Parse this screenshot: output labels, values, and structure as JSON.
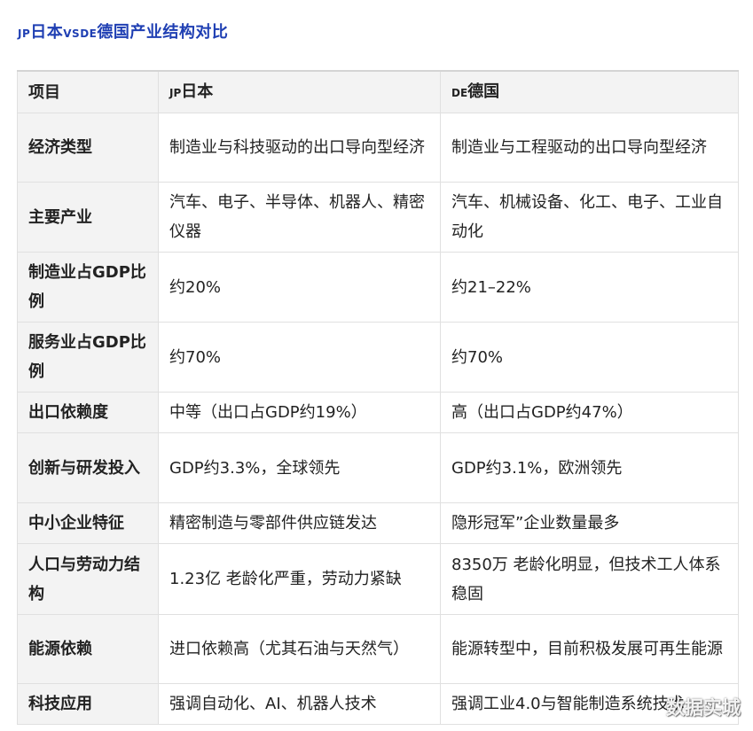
{
  "title": {
    "jp": "JP",
    "japan": "日本",
    "vsde": "VSDE",
    "rest": "德国产业结构对比"
  },
  "table": {
    "headers": {
      "item": "项目",
      "japan_code": "JP",
      "japan": "日本",
      "germany_code": "DE",
      "germany": "德国"
    },
    "rows": [
      {
        "label": "经济类型",
        "japan": "制造业与科技驱动的出口导向型经济",
        "germany": "制造业与工程驱动的出口导向型经济"
      },
      {
        "label": "主要产业",
        "japan": "汽车、电子、半导体、机器人、精密仪器",
        "germany": "汽车、机械设备、化工、电子、工业自动化"
      },
      {
        "label": "制造业占GDP比例",
        "japan": "约20%",
        "germany": "约21–22%"
      },
      {
        "label": "服务业占GDP比例",
        "japan": "约70%",
        "germany": "约70%"
      },
      {
        "label": "出口依赖度",
        "japan": "中等（出口占GDP约19%）",
        "germany": "高（出口占GDP约47%）"
      },
      {
        "label": "创新与研发投入",
        "japan": "GDP约3.3%，全球领先",
        "germany": "GDP约3.1%，欧洲领先"
      },
      {
        "label": "中小企业特征",
        "japan": "精密制造与零部件供应链发达",
        "germany": "隐形冠军”企业数量最多"
      },
      {
        "label": "人口与劳动力结构",
        "japan": "1.23亿 老龄化严重，劳动力紧缺",
        "germany": "8350万 老龄化明显，但技术工人体系稳固"
      },
      {
        "label": "能源依赖",
        "japan": "进口依赖高（尤其石油与天然气）",
        "germany": "能源转型中，目前积极发展可再生能源"
      },
      {
        "label": "科技应用",
        "japan": "强调自动化、AI、机器人技术",
        "germany": "强调工业4.0与智能制造系统技术"
      }
    ]
  },
  "watermark": "数据实城"
}
